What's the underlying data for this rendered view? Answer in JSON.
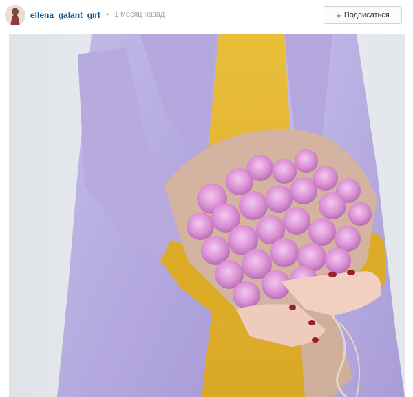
{
  "post": {
    "username": "ellena_galant_girl",
    "separator": "•",
    "timestamp": "1 месяц назад",
    "follow": {
      "icon": "+",
      "label": "Подписаться"
    }
  },
  "photo": {
    "subject": "bouquet-of-pink-roses",
    "colors": {
      "coat": "#b9aee0",
      "sweater": "#e2b530",
      "roses": "#d98fd4",
      "wrap": "#d7b8a6",
      "background": "#e6e9ee"
    }
  }
}
